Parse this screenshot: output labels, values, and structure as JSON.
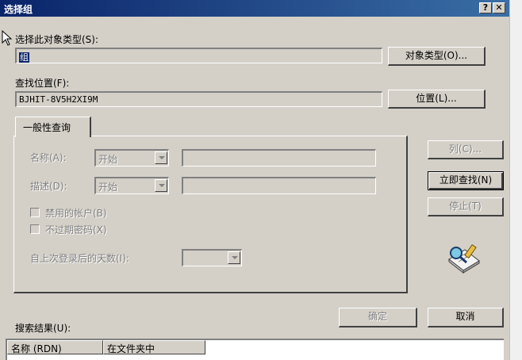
{
  "window": {
    "title": "选择组",
    "help_btn": "?",
    "close_btn": "✕"
  },
  "object_type": {
    "label": "选择此对象类型(S):",
    "value": "组",
    "button": "对象类型(O)..."
  },
  "location": {
    "label": "查找位置(F):",
    "value": "BJHIT-8V5H2XI9M",
    "button": "位置(L)..."
  },
  "tab": {
    "label": "一般性查询"
  },
  "query": {
    "name_label": "名称(A):",
    "name_mode": "开始",
    "desc_label": "描述(D):",
    "desc_mode": "开始",
    "disabled_accounts": "禁用的帐户(B)",
    "non_expiring_pw": "不过期密码(X)",
    "days_since_logon": "自上次登录后的天数(I):"
  },
  "side_buttons": {
    "columns": "列(C)...",
    "find_now": "立即查找(N)",
    "stop": "停止(T)"
  },
  "footer": {
    "ok": "确定",
    "cancel": "取消",
    "results_label": "搜索结果(U):"
  },
  "results_columns": [
    "名称 (RDN)",
    "在文件夹中"
  ],
  "icons": {
    "search_icon": "magnifier-over-notebook"
  }
}
